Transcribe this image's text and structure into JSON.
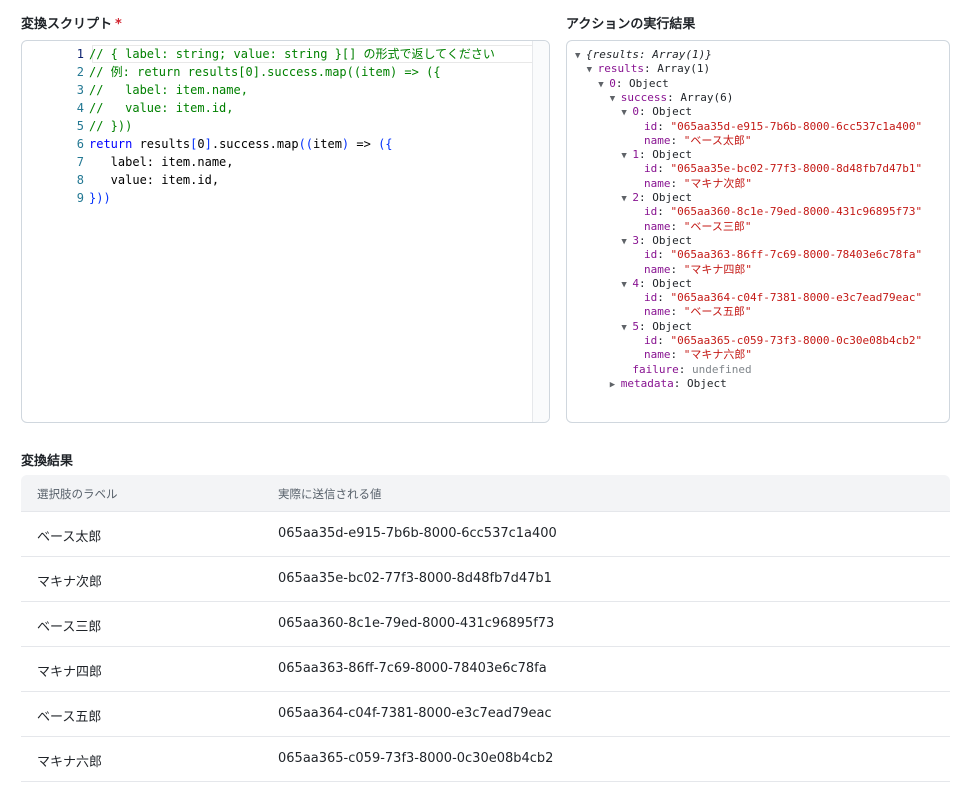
{
  "script_section": {
    "title": "変換スクリプト",
    "required_mark": "*"
  },
  "code_lines": [
    {
      "num": "1",
      "parts": [
        {
          "t": "// { label: string; value: string }[] の形式で返してください",
          "c": "c"
        }
      ]
    },
    {
      "num": "2",
      "parts": [
        {
          "t": "// 例: return results[0].success.map((item) => ({",
          "c": "c"
        }
      ]
    },
    {
      "num": "3",
      "parts": [
        {
          "t": "//   label: item.name,",
          "c": "c"
        }
      ]
    },
    {
      "num": "4",
      "parts": [
        {
          "t": "//   value: item.id,",
          "c": "c"
        }
      ]
    },
    {
      "num": "5",
      "parts": [
        {
          "t": "// }))",
          "c": "c"
        }
      ]
    },
    {
      "num": "6",
      "parts": [
        {
          "t": "return",
          "c": "kw"
        },
        {
          "t": " results",
          "c": "tx"
        },
        {
          "t": "[",
          "c": "br"
        },
        {
          "t": "0",
          "c": "tx"
        },
        {
          "t": "]",
          "c": "br"
        },
        {
          "t": ".success.map",
          "c": "tx"
        },
        {
          "t": "((",
          "c": "br"
        },
        {
          "t": "item",
          "c": "tx"
        },
        {
          "t": ")",
          "c": "br"
        },
        {
          "t": " => ",
          "c": "tx"
        },
        {
          "t": "({",
          "c": "br"
        }
      ]
    },
    {
      "num": "7",
      "parts": [
        {
          "t": "   label: item.name,",
          "c": "tx"
        }
      ]
    },
    {
      "num": "8",
      "parts": [
        {
          "t": "   value: item.id,",
          "c": "tx"
        }
      ]
    },
    {
      "num": "9",
      "parts": [
        {
          "t": "}))",
          "c": "br"
        }
      ]
    }
  ],
  "result_section": {
    "title": "アクションの実行結果"
  },
  "tree": [
    {
      "indent": 0,
      "arrow": "▼",
      "parts": [
        {
          "t": "{results: Array(1)}",
          "c": "it"
        }
      ]
    },
    {
      "indent": 1,
      "arrow": "▼",
      "parts": [
        {
          "t": "results",
          "c": "key"
        },
        {
          "t": ": Array(1)",
          "c": ""
        }
      ]
    },
    {
      "indent": 2,
      "arrow": "▼",
      "parts": [
        {
          "t": "0",
          "c": "key"
        },
        {
          "t": ": Object",
          "c": ""
        }
      ]
    },
    {
      "indent": 3,
      "arrow": "▼",
      "parts": [
        {
          "t": "success",
          "c": "key"
        },
        {
          "t": ": Array(6)",
          "c": ""
        }
      ]
    },
    {
      "indent": 4,
      "arrow": "▼",
      "parts": [
        {
          "t": "0",
          "c": "key"
        },
        {
          "t": ": Object",
          "c": ""
        }
      ]
    },
    {
      "indent": 5,
      "arrow": "",
      "parts": [
        {
          "t": "id",
          "c": "key"
        },
        {
          "t": ": ",
          "c": ""
        },
        {
          "t": "\"065aa35d-e915-7b6b-8000-6cc537c1a400\"",
          "c": "str"
        }
      ]
    },
    {
      "indent": 5,
      "arrow": "",
      "parts": [
        {
          "t": "name",
          "c": "key"
        },
        {
          "t": ": ",
          "c": ""
        },
        {
          "t": "\"ベース太郎\"",
          "c": "str"
        }
      ]
    },
    {
      "indent": 4,
      "arrow": "▼",
      "parts": [
        {
          "t": "1",
          "c": "key"
        },
        {
          "t": ": Object",
          "c": ""
        }
      ]
    },
    {
      "indent": 5,
      "arrow": "",
      "parts": [
        {
          "t": "id",
          "c": "key"
        },
        {
          "t": ": ",
          "c": ""
        },
        {
          "t": "\"065aa35e-bc02-77f3-8000-8d48fb7d47b1\"",
          "c": "str"
        }
      ]
    },
    {
      "indent": 5,
      "arrow": "",
      "parts": [
        {
          "t": "name",
          "c": "key"
        },
        {
          "t": ": ",
          "c": ""
        },
        {
          "t": "\"マキナ次郎\"",
          "c": "str"
        }
      ]
    },
    {
      "indent": 4,
      "arrow": "▼",
      "parts": [
        {
          "t": "2",
          "c": "key"
        },
        {
          "t": ": Object",
          "c": ""
        }
      ]
    },
    {
      "indent": 5,
      "arrow": "",
      "parts": [
        {
          "t": "id",
          "c": "key"
        },
        {
          "t": ": ",
          "c": ""
        },
        {
          "t": "\"065aa360-8c1e-79ed-8000-431c96895f73\"",
          "c": "str"
        }
      ]
    },
    {
      "indent": 5,
      "arrow": "",
      "parts": [
        {
          "t": "name",
          "c": "key"
        },
        {
          "t": ": ",
          "c": ""
        },
        {
          "t": "\"ベース三郎\"",
          "c": "str"
        }
      ]
    },
    {
      "indent": 4,
      "arrow": "▼",
      "parts": [
        {
          "t": "3",
          "c": "key"
        },
        {
          "t": ": Object",
          "c": ""
        }
      ]
    },
    {
      "indent": 5,
      "arrow": "",
      "parts": [
        {
          "t": "id",
          "c": "key"
        },
        {
          "t": ": ",
          "c": ""
        },
        {
          "t": "\"065aa363-86ff-7c69-8000-78403e6c78fa\"",
          "c": "str"
        }
      ]
    },
    {
      "indent": 5,
      "arrow": "",
      "parts": [
        {
          "t": "name",
          "c": "key"
        },
        {
          "t": ": ",
          "c": ""
        },
        {
          "t": "\"マキナ四郎\"",
          "c": "str"
        }
      ]
    },
    {
      "indent": 4,
      "arrow": "▼",
      "parts": [
        {
          "t": "4",
          "c": "key"
        },
        {
          "t": ": Object",
          "c": ""
        }
      ]
    },
    {
      "indent": 5,
      "arrow": "",
      "parts": [
        {
          "t": "id",
          "c": "key"
        },
        {
          "t": ": ",
          "c": ""
        },
        {
          "t": "\"065aa364-c04f-7381-8000-e3c7ead79eac\"",
          "c": "str"
        }
      ]
    },
    {
      "indent": 5,
      "arrow": "",
      "parts": [
        {
          "t": "name",
          "c": "key"
        },
        {
          "t": ": ",
          "c": ""
        },
        {
          "t": "\"ベース五郎\"",
          "c": "str"
        }
      ]
    },
    {
      "indent": 4,
      "arrow": "▼",
      "parts": [
        {
          "t": "5",
          "c": "key"
        },
        {
          "t": ": Object",
          "c": ""
        }
      ]
    },
    {
      "indent": 5,
      "arrow": "",
      "parts": [
        {
          "t": "id",
          "c": "key"
        },
        {
          "t": ": ",
          "c": ""
        },
        {
          "t": "\"065aa365-c059-73f3-8000-0c30e08b4cb2\"",
          "c": "str"
        }
      ]
    },
    {
      "indent": 5,
      "arrow": "",
      "parts": [
        {
          "t": "name",
          "c": "key"
        },
        {
          "t": ": ",
          "c": ""
        },
        {
          "t": "\"マキナ六郎\"",
          "c": "str"
        }
      ]
    },
    {
      "indent": 4,
      "arrow": "",
      "parts": [
        {
          "t": "failure",
          "c": "key"
        },
        {
          "t": ": ",
          "c": ""
        },
        {
          "t": "undefined",
          "c": "undef"
        }
      ]
    },
    {
      "indent": 3,
      "arrow": "▶",
      "parts": [
        {
          "t": "metadata",
          "c": "key"
        },
        {
          "t": ": Object",
          "c": ""
        }
      ]
    }
  ],
  "table_section": {
    "title": "変換結果"
  },
  "table": {
    "headers": [
      "選択肢のラベル",
      "実際に送信される値"
    ],
    "rows": [
      {
        "label": "ベース太郎",
        "value": "065aa35d-e915-7b6b-8000-6cc537c1a400"
      },
      {
        "label": "マキナ次郎",
        "value": "065aa35e-bc02-77f3-8000-8d48fb7d47b1"
      },
      {
        "label": "ベース三郎",
        "value": "065aa360-8c1e-79ed-8000-431c96895f73"
      },
      {
        "label": "マキナ四郎",
        "value": "065aa363-86ff-7c69-8000-78403e6c78fa"
      },
      {
        "label": "ベース五郎",
        "value": "065aa364-c04f-7381-8000-e3c7ead79eac"
      },
      {
        "label": "マキナ六郎",
        "value": "065aa365-c059-73f3-8000-0c30e08b4cb2"
      }
    ]
  }
}
